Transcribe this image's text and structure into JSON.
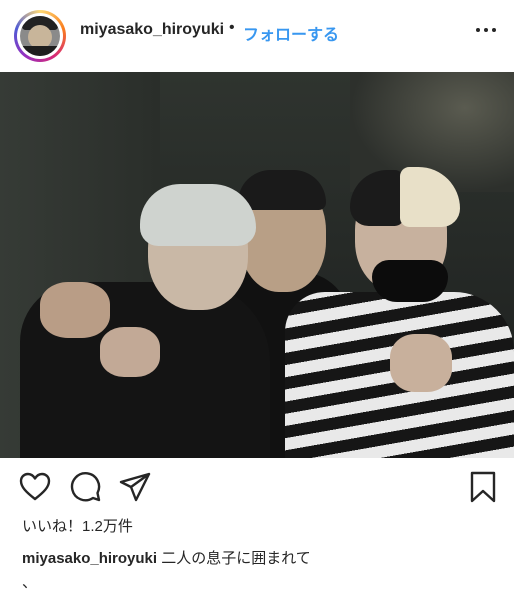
{
  "header": {
    "avatar_icon": "profile-avatar",
    "username": "miyasako_hiroyuki",
    "separator": "•",
    "follow_label": "フォローする",
    "more_icon": "more-options-icon"
  },
  "post": {
    "photo_description_icon": "post-photo"
  },
  "actions": {
    "like_icon": "heart-icon",
    "comment_icon": "comment-icon",
    "share_icon": "paper-plane-icon",
    "save_icon": "bookmark-icon"
  },
  "likes": {
    "text": "いいね！1.2万件"
  },
  "caption": {
    "username": "miyasako_hiroyuki",
    "text": "二人の息子に囲まれて",
    "extra": "、"
  },
  "colors": {
    "link_blue": "#3897f0",
    "text": "#262626"
  }
}
